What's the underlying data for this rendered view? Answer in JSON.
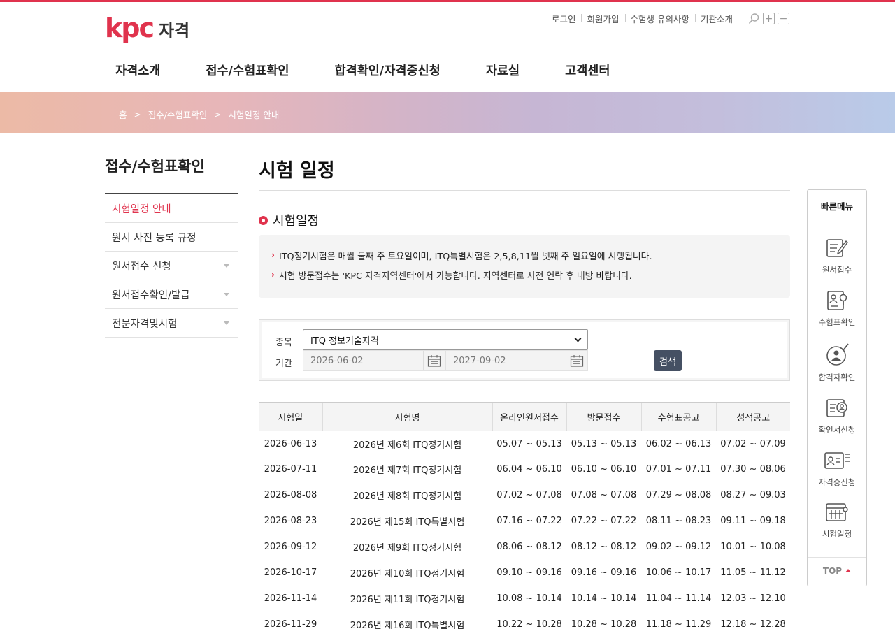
{
  "logo": {
    "mark": "kpc",
    "text": "자격"
  },
  "util": {
    "login": "로그인",
    "join": "회원가입",
    "notice": "수험생 유의사항",
    "about": "기관소개"
  },
  "gnb": [
    "자격소개",
    "접수/수험표확인",
    "합격확인/자격증신청",
    "자료실",
    "고객센터"
  ],
  "breadcrumb": {
    "home": "홈",
    "level1": "접수/수험표확인",
    "level2": "시험일정 안내"
  },
  "lnb": {
    "title": "접수/수험표확인",
    "items": [
      {
        "label": "시험일정 안내",
        "active": true
      },
      {
        "label": "원서 사진 등록 규정"
      },
      {
        "label": "원서접수 신청"
      },
      {
        "label": "원서접수확인/발급"
      },
      {
        "label": "전문자격및시험"
      }
    ]
  },
  "main": {
    "title": "시험 일정",
    "section_title": "시험일정",
    "notices": [
      "ITQ정기시험은 매월 둘째 주 토요일이며, ITQ특별시험은 2,5,8,11월 넷째 주 일요일에 시행됩니다.",
      "시험 방문접수는 'KPC 자격지역센터'에서 가능합니다. 지역센터로 사전 연락 후 내방 바랍니다."
    ]
  },
  "search": {
    "type_label": "종목",
    "type_value": "ITQ 정보기술자격",
    "period_label": "기간",
    "date_from": "2026-06-02",
    "date_to": "2027-09-02",
    "button": "검색"
  },
  "table": {
    "headers": [
      "시험일",
      "시험명",
      "온라인원서접수",
      "방문접수",
      "수험표공고",
      "성적공고"
    ],
    "rows": [
      [
        "2026-06-13",
        "2026년 제6회 ITQ정기시험",
        "05.07 ~ 05.13",
        "05.13 ~ 05.13",
        "06.02 ~ 06.13",
        "07.02 ~ 07.09"
      ],
      [
        "2026-07-11",
        "2026년 제7회 ITQ정기시험",
        "06.04 ~ 06.10",
        "06.10 ~ 06.10",
        "07.01 ~ 07.11",
        "07.30 ~ 08.06"
      ],
      [
        "2026-08-08",
        "2026년 제8회 ITQ정기시험",
        "07.02 ~ 07.08",
        "07.08 ~ 07.08",
        "07.29 ~ 08.08",
        "08.27 ~ 09.03"
      ],
      [
        "2026-08-23",
        "2026년 제15회 ITQ특별시험",
        "07.16 ~ 07.22",
        "07.22 ~ 07.22",
        "08.11 ~ 08.23",
        "09.11 ~ 09.18"
      ],
      [
        "2026-09-12",
        "2026년 제9회 ITQ정기시험",
        "08.06 ~ 08.12",
        "08.12 ~ 08.12",
        "09.02 ~ 09.12",
        "10.01 ~ 10.08"
      ],
      [
        "2026-10-17",
        "2026년 제10회 ITQ정기시험",
        "09.10 ~ 09.16",
        "09.16 ~ 09.16",
        "10.06 ~ 10.17",
        "11.05 ~ 11.12"
      ],
      [
        "2026-11-14",
        "2026년 제11회 ITQ정기시험",
        "10.08 ~ 10.14",
        "10.14 ~ 10.14",
        "11.04 ~ 11.14",
        "12.03 ~ 12.10"
      ],
      [
        "2026-11-29",
        "2026년 제16회 ITQ특별시험",
        "10.22 ~ 10.28",
        "10.28 ~ 10.28",
        "11.18 ~ 11.29",
        "12.18 ~ 12.28"
      ]
    ]
  },
  "quick": {
    "title": "빠른메뉴",
    "items": [
      "원서접수",
      "수험표확인",
      "합격자확인",
      "확인서신청",
      "자격증신청",
      "시험일정"
    ],
    "top": "TOP"
  },
  "colors": {
    "accent": "#e0334d",
    "button": "#455063"
  }
}
